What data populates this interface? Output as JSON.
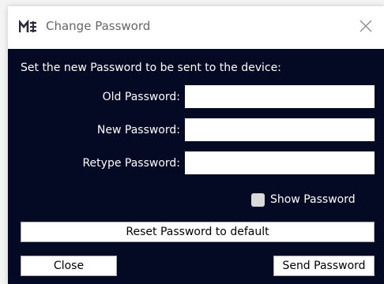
{
  "window": {
    "title": "Change Password",
    "app_icon": "nordic-logo-icon",
    "close_icon": "close-icon"
  },
  "dialog": {
    "instruction": "Set the new Password to be sent to the device:",
    "fields": [
      {
        "label": "Old Password:",
        "value": ""
      },
      {
        "label": "New Password:",
        "value": ""
      },
      {
        "label": "Retype Password:",
        "value": ""
      }
    ],
    "show_password": {
      "label": "Show Password",
      "checked": false
    },
    "reset_button": "Reset Password to default",
    "close_button": "Close",
    "send_button": "Send Password"
  },
  "colors": {
    "background": "#050a24",
    "text": "#ffffff"
  }
}
